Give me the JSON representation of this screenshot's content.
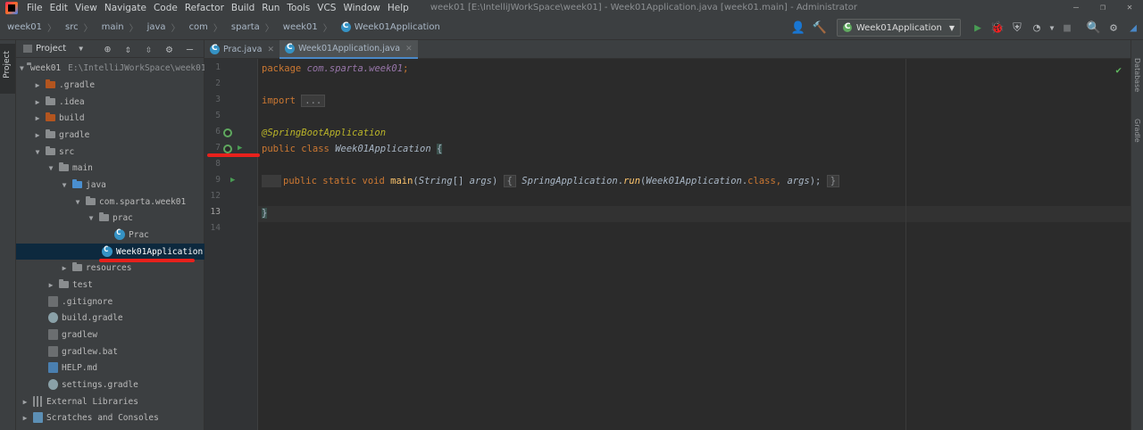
{
  "menubar": {
    "items": [
      "File",
      "Edit",
      "View",
      "Navigate",
      "Code",
      "Refactor",
      "Build",
      "Run",
      "Tools",
      "VCS",
      "Window",
      "Help"
    ],
    "window_title": "week01 [E:\\IntelliJWorkSpace\\week01] - Week01Application.java [week01.main] - Administrator"
  },
  "breadcrumbs": [
    "week01",
    "src",
    "main",
    "java",
    "com",
    "sparta",
    "week01",
    "Week01Application"
  ],
  "toolbar": {
    "run_config": "Week01Application"
  },
  "left_stripe": {
    "project_tab": "Project"
  },
  "right_stripe": {
    "database_tab": "Database",
    "gradle_tab": "Gradle"
  },
  "project_panel": {
    "title": "Project",
    "tree": [
      {
        "label": "week01",
        "hint": "E:\\IntelliJWorkSpace\\week01"
      },
      {
        "label": ".gradle"
      },
      {
        "label": ".idea"
      },
      {
        "label": "build"
      },
      {
        "label": "gradle"
      },
      {
        "label": "src"
      },
      {
        "label": "main"
      },
      {
        "label": "java"
      },
      {
        "label": "com.sparta.week01"
      },
      {
        "label": "prac"
      },
      {
        "label": "Prac"
      },
      {
        "label": "Week01Application"
      },
      {
        "label": "resources"
      },
      {
        "label": "test"
      },
      {
        "label": ".gitignore"
      },
      {
        "label": "build.gradle"
      },
      {
        "label": "gradlew"
      },
      {
        "label": "gradlew.bat"
      },
      {
        "label": "HELP.md"
      },
      {
        "label": "settings.gradle"
      },
      {
        "label": "External Libraries"
      },
      {
        "label": "Scratches and Consoles"
      }
    ]
  },
  "editor": {
    "tabs": [
      {
        "label": "Prac.java"
      },
      {
        "label": "Week01Application.java"
      }
    ],
    "line_numbers": [
      "1",
      "2",
      "3",
      "5",
      "6",
      "7",
      "8",
      "9",
      "12",
      "13",
      "14"
    ],
    "code": {
      "l1_kw": "package",
      "l1_pkg": "com.sparta.week01",
      "l1_semi": ";",
      "l3_kw": "import",
      "l3_fold": "...",
      "l6_ann": "@SpringBootApplication",
      "l7_kw": "public class",
      "l7_cls": "Week01Application",
      "l7_brace": "{",
      "l9_kw": "public static void",
      "l9_fn": "main",
      "l9_open": "(",
      "l9_type": "String",
      "l9_arr": "[]",
      "l9_param": "args",
      "l9_close": ")",
      "l9_fold_open": "{",
      "l9_call_cls": "SpringApplication",
      "l9_dot": ".",
      "l9_call_fn": "run",
      "l9_paren_open": "(",
      "l9_arg_cls": "Week01Application",
      "l9_dot2": ".",
      "l9_class_kw": "class",
      "l9_comma": ",",
      "l9_arg": "args",
      "l9_paren_close": ");",
      "l9_fold_close": "}",
      "l13_brace": "}"
    }
  },
  "colors": {
    "annotation_marks": "#e8211c",
    "keyword": "#cc7832",
    "run_icon": "#499c54"
  }
}
